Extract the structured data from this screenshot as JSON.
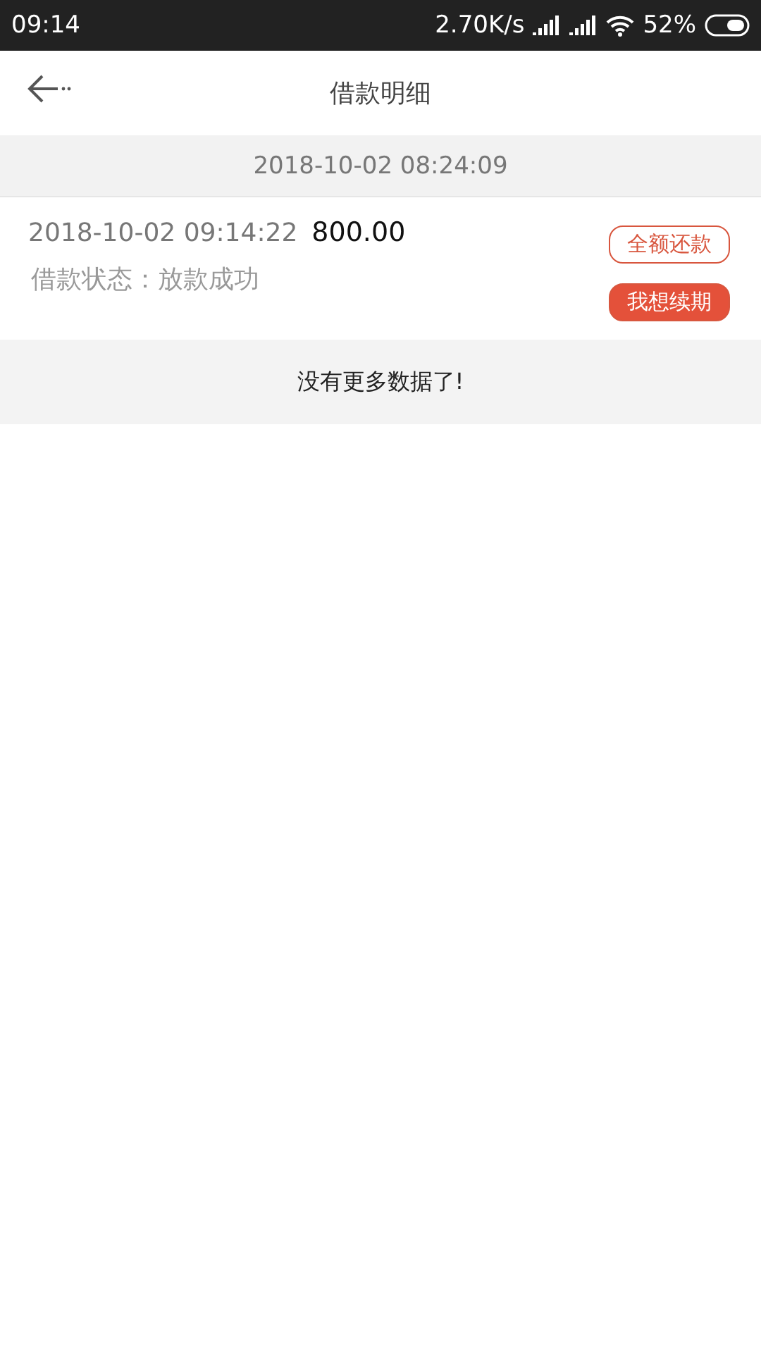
{
  "status_bar": {
    "time": "09:14",
    "speed": "2.70K/s",
    "battery": "52%"
  },
  "header": {
    "title": "借款明细"
  },
  "group_date": "2018-10-02 08:24:09",
  "records": [
    {
      "datetime": "2018-10-02 09:14:22",
      "amount": "800.00",
      "status": "借款状态：放款成功",
      "buttons": [
        {
          "label": "全额还款",
          "kind": "outline"
        },
        {
          "label": "我想续期",
          "kind": "filled"
        }
      ]
    }
  ],
  "footer_note": "没有更多数据了!"
}
